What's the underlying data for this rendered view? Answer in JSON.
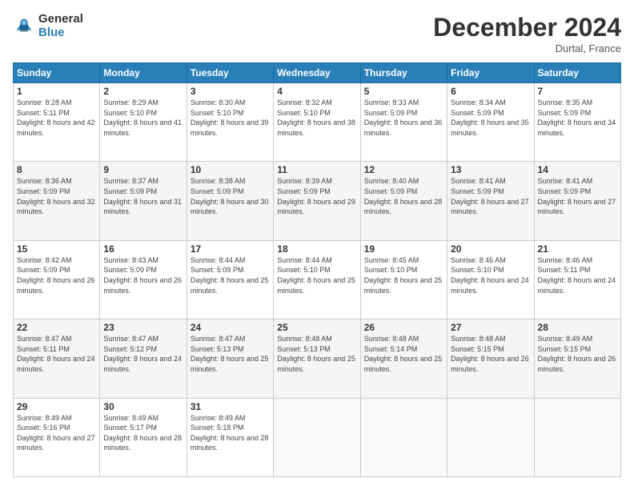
{
  "logo": {
    "general": "General",
    "blue": "Blue"
  },
  "title": "December 2024",
  "location": "Durtal, France",
  "days_of_week": [
    "Sunday",
    "Monday",
    "Tuesday",
    "Wednesday",
    "Thursday",
    "Friday",
    "Saturday"
  ],
  "weeks": [
    [
      {
        "day": "1",
        "sunrise": "8:28 AM",
        "sunset": "5:11 PM",
        "daylight": "8 hours and 42 minutes."
      },
      {
        "day": "2",
        "sunrise": "8:29 AM",
        "sunset": "5:10 PM",
        "daylight": "8 hours and 41 minutes."
      },
      {
        "day": "3",
        "sunrise": "8:30 AM",
        "sunset": "5:10 PM",
        "daylight": "8 hours and 39 minutes."
      },
      {
        "day": "4",
        "sunrise": "8:32 AM",
        "sunset": "5:10 PM",
        "daylight": "8 hours and 38 minutes."
      },
      {
        "day": "5",
        "sunrise": "8:33 AM",
        "sunset": "5:09 PM",
        "daylight": "8 hours and 36 minutes."
      },
      {
        "day": "6",
        "sunrise": "8:34 AM",
        "sunset": "5:09 PM",
        "daylight": "8 hours and 35 minutes."
      },
      {
        "day": "7",
        "sunrise": "8:35 AM",
        "sunset": "5:09 PM",
        "daylight": "8 hours and 34 minutes."
      }
    ],
    [
      {
        "day": "8",
        "sunrise": "8:36 AM",
        "sunset": "5:09 PM",
        "daylight": "8 hours and 32 minutes."
      },
      {
        "day": "9",
        "sunrise": "8:37 AM",
        "sunset": "5:09 PM",
        "daylight": "8 hours and 31 minutes."
      },
      {
        "day": "10",
        "sunrise": "8:38 AM",
        "sunset": "5:09 PM",
        "daylight": "8 hours and 30 minutes."
      },
      {
        "day": "11",
        "sunrise": "8:39 AM",
        "sunset": "5:09 PM",
        "daylight": "8 hours and 29 minutes."
      },
      {
        "day": "12",
        "sunrise": "8:40 AM",
        "sunset": "5:09 PM",
        "daylight": "8 hours and 28 minutes."
      },
      {
        "day": "13",
        "sunrise": "8:41 AM",
        "sunset": "5:09 PM",
        "daylight": "8 hours and 27 minutes."
      },
      {
        "day": "14",
        "sunrise": "8:41 AM",
        "sunset": "5:09 PM",
        "daylight": "8 hours and 27 minutes."
      }
    ],
    [
      {
        "day": "15",
        "sunrise": "8:42 AM",
        "sunset": "5:09 PM",
        "daylight": "8 hours and 26 minutes."
      },
      {
        "day": "16",
        "sunrise": "8:43 AM",
        "sunset": "5:09 PM",
        "daylight": "8 hours and 26 minutes."
      },
      {
        "day": "17",
        "sunrise": "8:44 AM",
        "sunset": "5:09 PM",
        "daylight": "8 hours and 25 minutes."
      },
      {
        "day": "18",
        "sunrise": "8:44 AM",
        "sunset": "5:10 PM",
        "daylight": "8 hours and 25 minutes."
      },
      {
        "day": "19",
        "sunrise": "8:45 AM",
        "sunset": "5:10 PM",
        "daylight": "8 hours and 25 minutes."
      },
      {
        "day": "20",
        "sunrise": "8:46 AM",
        "sunset": "5:10 PM",
        "daylight": "8 hours and 24 minutes."
      },
      {
        "day": "21",
        "sunrise": "8:46 AM",
        "sunset": "5:11 PM",
        "daylight": "8 hours and 24 minutes."
      }
    ],
    [
      {
        "day": "22",
        "sunrise": "8:47 AM",
        "sunset": "5:11 PM",
        "daylight": "8 hours and 24 minutes."
      },
      {
        "day": "23",
        "sunrise": "8:47 AM",
        "sunset": "5:12 PM",
        "daylight": "8 hours and 24 minutes."
      },
      {
        "day": "24",
        "sunrise": "8:47 AM",
        "sunset": "5:13 PM",
        "daylight": "8 hours and 25 minutes."
      },
      {
        "day": "25",
        "sunrise": "8:48 AM",
        "sunset": "5:13 PM",
        "daylight": "8 hours and 25 minutes."
      },
      {
        "day": "26",
        "sunrise": "8:48 AM",
        "sunset": "5:14 PM",
        "daylight": "8 hours and 25 minutes."
      },
      {
        "day": "27",
        "sunrise": "8:48 AM",
        "sunset": "5:15 PM",
        "daylight": "8 hours and 26 minutes."
      },
      {
        "day": "28",
        "sunrise": "8:49 AM",
        "sunset": "5:15 PM",
        "daylight": "8 hours and 26 minutes."
      }
    ],
    [
      {
        "day": "29",
        "sunrise": "8:49 AM",
        "sunset": "5:16 PM",
        "daylight": "8 hours and 27 minutes."
      },
      {
        "day": "30",
        "sunrise": "8:49 AM",
        "sunset": "5:17 PM",
        "daylight": "8 hours and 28 minutes."
      },
      {
        "day": "31",
        "sunrise": "8:49 AM",
        "sunset": "5:18 PM",
        "daylight": "8 hours and 28 minutes."
      },
      null,
      null,
      null,
      null
    ]
  ],
  "labels": {
    "sunrise": "Sunrise:",
    "sunset": "Sunset:",
    "daylight": "Daylight:"
  }
}
